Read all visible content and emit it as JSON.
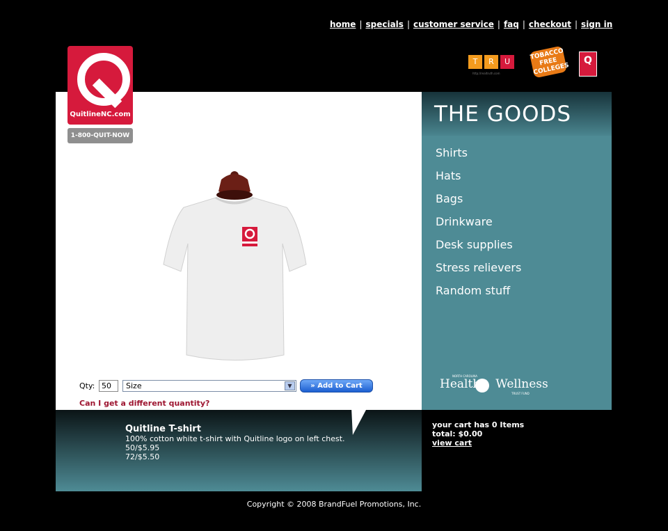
{
  "nav": {
    "items": [
      "home",
      "specials",
      "customer service",
      "faq",
      "checkout",
      "sign in"
    ],
    "separator": "|"
  },
  "brand": {
    "logo_text": "QuitlineNC.com",
    "phone": "1-800-QUIT-NOW",
    "logo_color": "#d61a3c"
  },
  "badges": {
    "tru_letters": [
      "T",
      "R",
      "U"
    ],
    "tru_colors": [
      "#f39b1e",
      "#f39b1e",
      "#d61a3c"
    ],
    "tru_sub": "http://realtruth.com",
    "tobacco_free": "TOBACCO FREE COLLEGES",
    "mini_logo": "Q"
  },
  "product": {
    "qty_label": "Qty:",
    "qty_value": "50",
    "size_selected": "Size",
    "add_to_cart": "» Add to Cart",
    "different_qty_link": "Can I get a different quantity?",
    "name": "Quitline T-shirt",
    "description": "100% cotton white t-shirt with Quitline logo on left chest.",
    "prices": [
      "50/$5.95",
      "72/$5.50"
    ]
  },
  "goods": {
    "title": "THE GOODS",
    "categories": [
      "Shirts",
      "Hats",
      "Bags",
      "Drinkware",
      "Desk supplies",
      "Stress relievers",
      "Random stuff"
    ],
    "health_top": "NORTH CAROLINA",
    "health_left": "Health",
    "health_right": "Wellness",
    "health_bottom": "TRUST FUND"
  },
  "cart": {
    "items_text": "your cart has 0 Items",
    "total_text": "total: $0.00",
    "view_cart": "view cart"
  },
  "footer": {
    "copyright": "Copyright © 2008 BrandFuel Promotions, Inc."
  },
  "colors": {
    "accent_teal": "#4e8b95",
    "link_red": "#9d1530"
  }
}
